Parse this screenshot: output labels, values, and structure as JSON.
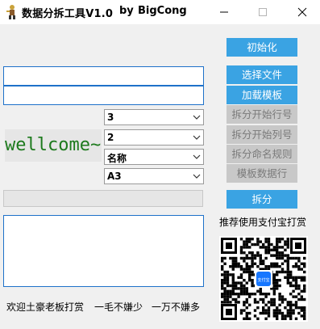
{
  "window": {
    "title": "数据分拆工具V1.0",
    "by": "by",
    "author": "BigCong"
  },
  "inputs": {
    "file_path": "",
    "template_path": ""
  },
  "welcome": "wellcome~",
  "combos": [
    {
      "value": "3"
    },
    {
      "value": "2"
    },
    {
      "value": "名称"
    },
    {
      "value": "A3"
    }
  ],
  "progress": {
    "value": 0
  },
  "buttons": {
    "init": "初始化",
    "select_file": "选择文件",
    "load_template": "加载模板",
    "split_start_row": "拆分开始行号",
    "split_start_col": "拆分开始列号",
    "split_naming_rule": "拆分命名规则",
    "template_data_row": "模板数据行",
    "split": "拆分"
  },
  "donate": {
    "label": "推荐使用支付宝打赏",
    "qr_center_text": "支付宝"
  },
  "log_text": "",
  "footer": {
    "part1": "欢迎土豪老板打赏",
    "part2": "一毛不嫌少",
    "part3": "一万不嫌多"
  },
  "colors": {
    "accent": "#3aa3e3",
    "input_border": "#1e71c9",
    "welcome": "#1d7a1d",
    "disabled": "#c8c8c8"
  },
  "icons": [
    "app-icon",
    "minimize-icon",
    "maximize-icon",
    "close-icon",
    "chevron-down-icon",
    "qr-code"
  ]
}
